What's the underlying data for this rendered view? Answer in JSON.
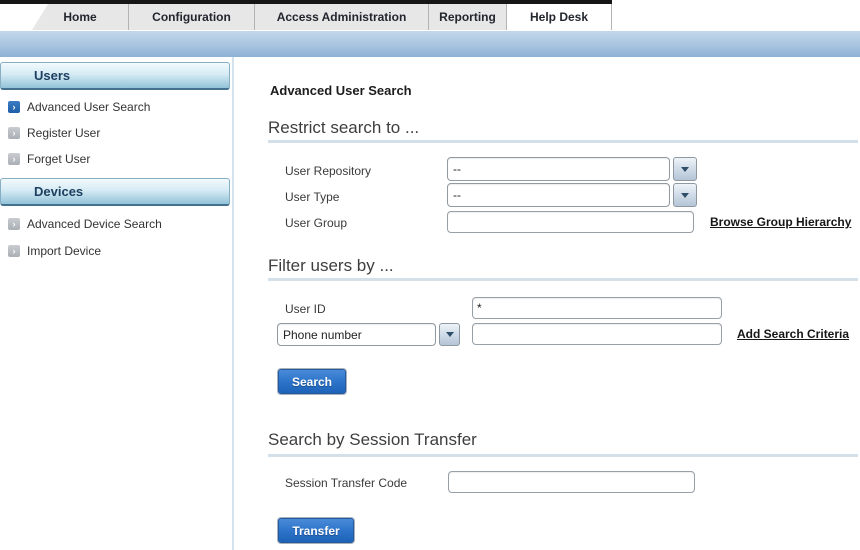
{
  "tabs": [
    {
      "label": "Home",
      "active": false
    },
    {
      "label": "Configuration",
      "active": false
    },
    {
      "label": "Access Administration",
      "active": false
    },
    {
      "label": "Reporting",
      "active": false
    },
    {
      "label": "Help Desk",
      "active": true
    }
  ],
  "sidebar": {
    "sections": [
      {
        "title": "Users",
        "items": [
          {
            "label": "Advanced User Search",
            "active": true
          },
          {
            "label": "Register User",
            "active": false
          },
          {
            "label": "Forget User",
            "active": false
          }
        ]
      },
      {
        "title": "Devices",
        "items": [
          {
            "label": "Advanced Device Search",
            "active": false
          },
          {
            "label": "Import Device",
            "active": false
          }
        ]
      }
    ]
  },
  "main": {
    "page_title": "Advanced User Search",
    "restrict": {
      "heading": "Restrict search to ...",
      "user_repository_label": "User Repository",
      "user_repository_value": "--",
      "user_type_label": "User Type",
      "user_type_value": "--",
      "user_group_label": "User Group",
      "user_group_value": "",
      "browse_link": "Browse Group Hierarchy"
    },
    "filter": {
      "heading": "Filter users by ...",
      "user_id_label": "User ID",
      "user_id_value": "*",
      "criteria_field_value": "Phone number",
      "criteria_value": "",
      "add_criteria_link": "Add Search Criteria",
      "search_button": "Search"
    },
    "session": {
      "heading": "Search by Session Transfer",
      "code_label": "Session Transfer Code",
      "code_value": "",
      "transfer_button": "Transfer"
    }
  },
  "colors": {
    "banner_top": "#c3d7ea",
    "banner_bottom": "#8db1d4",
    "button_top": "#4a8bd8",
    "button_bottom": "#1e63b8",
    "section_divider": "#d3dfe9",
    "tab_bg": "#e7e7e7",
    "active_tab_bg": "#ffffff",
    "sidebar_header_top": "#f2fafd",
    "sidebar_header_bottom": "#93c2d8",
    "active_item_icon": "#2e6db8",
    "inactive_item_icon": "#b9bdc1"
  }
}
